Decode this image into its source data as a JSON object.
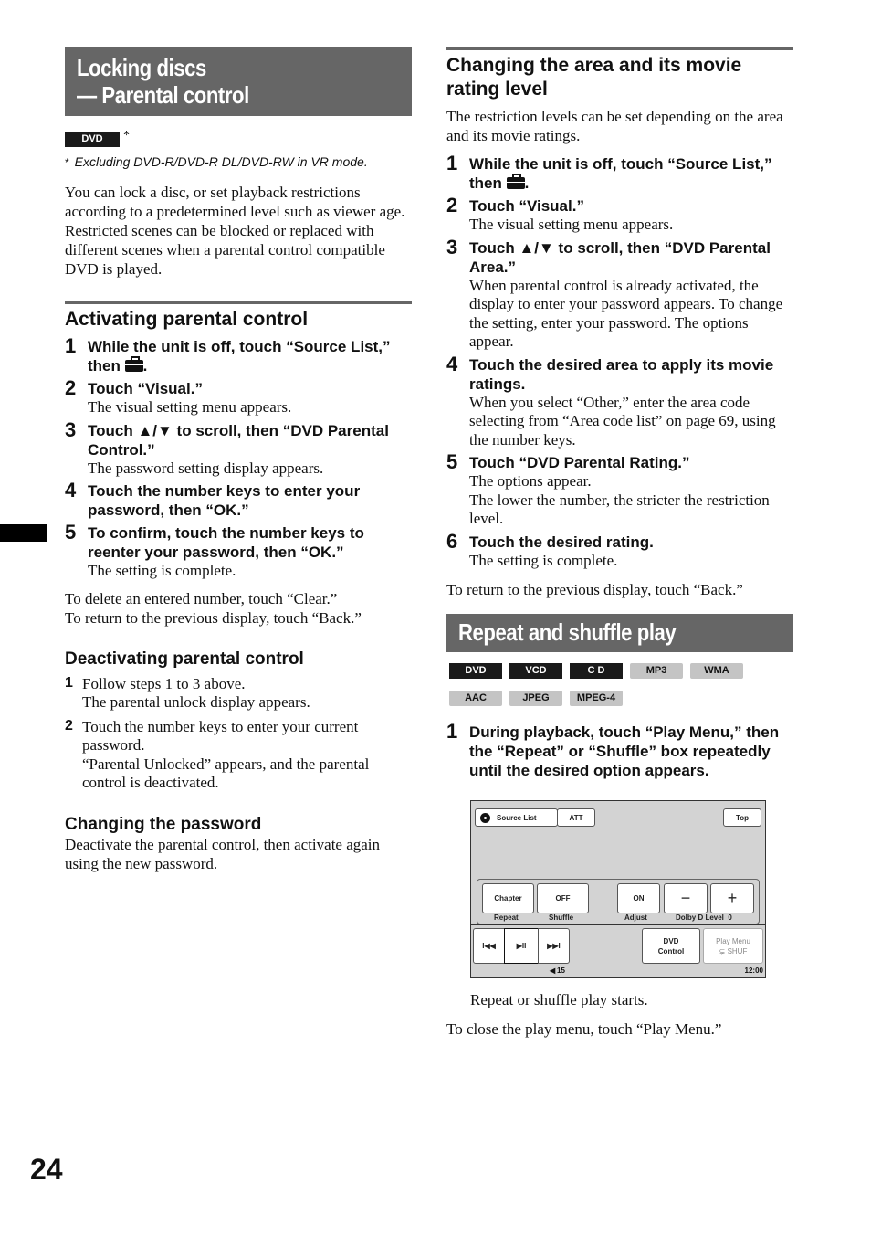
{
  "page_number": "24",
  "left": {
    "section_title_line1": "Locking discs",
    "section_title_line2": "— Parental control",
    "badges": [
      "DVD"
    ],
    "badge_asterisk": "*",
    "footnote_mark": "*",
    "footnote": "Excluding DVD-R/DVD-R DL/DVD-RW in VR mode.",
    "intro": "You can lock a disc, or set playback restrictions according to a predetermined level such as viewer age. Restricted scenes can be blocked or replaced with different scenes when a parental control compatible DVD is played.",
    "activating": {
      "heading": "Activating parental control",
      "steps": [
        {
          "num": "1",
          "title_before_icon": "While the unit is off, touch “Source List,” then ",
          "title_after_icon": ".",
          "desc": ""
        },
        {
          "num": "2",
          "title": "Touch “Visual.”",
          "desc": "The visual setting menu appears."
        },
        {
          "num": "3",
          "title": "Touch ▲/▼ to scroll, then “DVD Parental Control.”",
          "desc": "The password setting display appears."
        },
        {
          "num": "4",
          "title": "Touch the number keys to enter your password, then “OK.”",
          "desc": ""
        },
        {
          "num": "5",
          "title": "To confirm, touch the number keys to reenter your password, then “OK.”",
          "desc": "The setting is complete."
        }
      ],
      "notes": [
        "To delete an entered number, touch “Clear.”",
        "To return to the previous display, touch “Back.”"
      ]
    },
    "deactivating": {
      "heading": "Deactivating parental control",
      "steps": [
        {
          "num": "1",
          "text": "Follow steps 1 to 3 above.",
          "desc": "The parental unlock display appears."
        },
        {
          "num": "2",
          "text": "Touch the number keys to enter your current password.",
          "desc": "“Parental Unlocked” appears, and the parental control is deactivated."
        }
      ]
    },
    "password": {
      "heading": "Changing the password",
      "text": "Deactivate the parental control, then activate again using the new password."
    }
  },
  "right": {
    "area": {
      "heading": "Changing the area and its movie rating level",
      "intro": "The restriction levels can be set depending on the area and its movie ratings.",
      "steps": [
        {
          "num": "1",
          "title_before_icon": "While the unit is off, touch “Source List,” then ",
          "title_after_icon": ".",
          "desc": ""
        },
        {
          "num": "2",
          "title": "Touch “Visual.”",
          "desc": "The visual setting menu appears."
        },
        {
          "num": "3",
          "title": "Touch ▲/▼ to scroll, then “DVD Parental Area.”",
          "desc": "When parental control is already activated, the display to enter your password appears. To change the setting, enter your password. The options appear."
        },
        {
          "num": "4",
          "title": "Touch the desired area to apply its movie ratings.",
          "desc": "When you select “Other,” enter the area code selecting from “Area code list” on page 69, using the number keys."
        },
        {
          "num": "5",
          "title": "Touch “DVD Parental Rating.”",
          "desc": "The options appear.\nThe lower the number, the stricter the restriction level."
        },
        {
          "num": "6",
          "title": "Touch the desired rating.",
          "desc": "The setting is complete."
        }
      ],
      "note": "To return to the previous display, touch “Back.”"
    },
    "repeat": {
      "section_title": "Repeat and shuffle play",
      "badges_dark": [
        "DVD",
        "VCD",
        "C D"
      ],
      "badges_light_row1": [
        "MP3",
        "WMA"
      ],
      "badges_light_row2": [
        "AAC",
        "JPEG",
        "MPEG-4"
      ],
      "step": {
        "num": "1",
        "title": "During playback, touch “Play Menu,” then the “Repeat” or “Shuffle” box repeatedly until the desired option appears."
      },
      "result": "Repeat or shuffle play starts.",
      "close_note": "To close the play menu, touch “Play Menu.”",
      "screen": {
        "source_list": "Source List",
        "att": "ATT",
        "top": "Top",
        "repeat_value": "Chapter",
        "repeat_label": "Repeat",
        "shuffle_value": "OFF",
        "shuffle_label": "Shuffle",
        "adjust_value": "ON",
        "adjust_label": "Adjust",
        "minus": "−",
        "plus": "+",
        "dolby_label": "Dolby D Level  0",
        "prev": "I◀◀",
        "play_pause": "▶II",
        "next": "▶▶I",
        "dvd_control_line1": "DVD",
        "dvd_control_line2": "Control",
        "play_menu_line1": "Play Menu",
        "play_menu_line2": "⊊ SHUF",
        "volume": "15",
        "clock": "12:00"
      }
    }
  }
}
